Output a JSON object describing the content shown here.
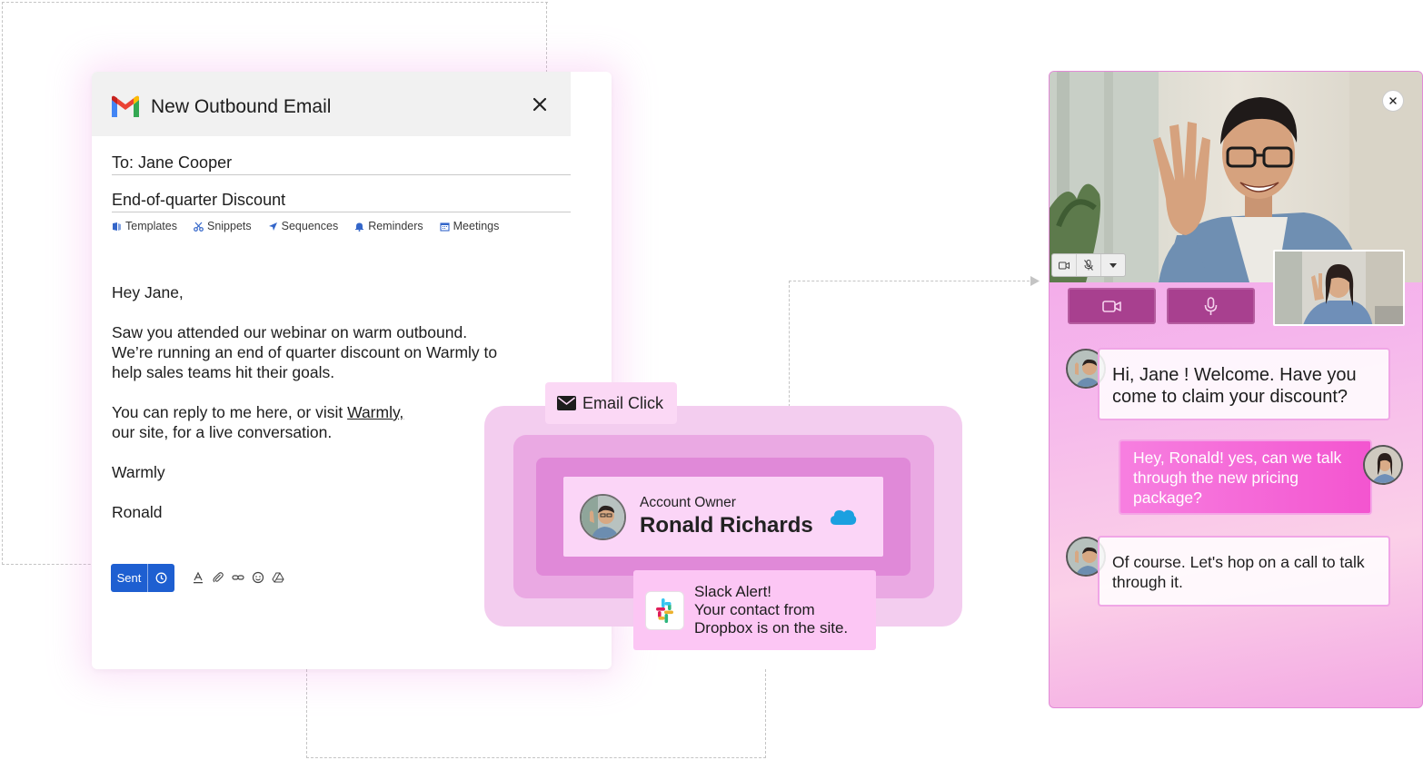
{
  "email": {
    "title": "New Outbound Email",
    "to": "To: Jane Cooper",
    "subject": "End-of-quarter Discount",
    "tools": [
      "Templates",
      "Snippets",
      "Sequences",
      "Reminders",
      "Meetings"
    ],
    "greeting": "Hey Jane,",
    "para1_line1": "Saw you attended our webinar on warm outbound.",
    "para1_line2": "We’re running an end of quarter discount on Warmly to",
    "para1_line3": "help sales teams hit their goals.",
    "para2_prefix": "You can reply to me here, or visit ",
    "para2_link": "Warmly,",
    "para2_line2": "our site, for a live conversation.",
    "signoff": "Warmly",
    "signature": "Ronald",
    "send_label": "Sent"
  },
  "center": {
    "email_click": "Email Click",
    "owner_label": "Account Owner",
    "owner_name": "Ronald Richards",
    "slack_line1": "Slack Alert!",
    "slack_line2": "Your contact from",
    "slack_line3": "Dropbox is on the site."
  },
  "chat": {
    "msg1": "Hi, Jane ! Welcome. Have you come to claim your discount?",
    "msg2": "Hey, Ronald! yes, can we talk through the new pricing package?",
    "msg3": "Of course. Let's hop on a call to talk through it."
  },
  "colors": {
    "send_button": "#1e5fd1",
    "gmail_red": "#ea4335",
    "slack_card": "#fcc6f4",
    "widget_button": "#a8408f",
    "user_bubble": "#f355d0"
  },
  "icons": [
    "gmail-logo",
    "close-icon",
    "templates-icon",
    "scissors-icon",
    "send-icon",
    "bell-icon",
    "calendar-icon",
    "clock-icon",
    "text-format-icon",
    "paperclip-icon",
    "link-icon",
    "emoji-icon",
    "drive-icon",
    "envelope-icon",
    "salesforce-icon",
    "slack-icon",
    "video-camera-icon",
    "microphone-icon",
    "microphone-off-icon",
    "dropdown-arrow-icon"
  ]
}
